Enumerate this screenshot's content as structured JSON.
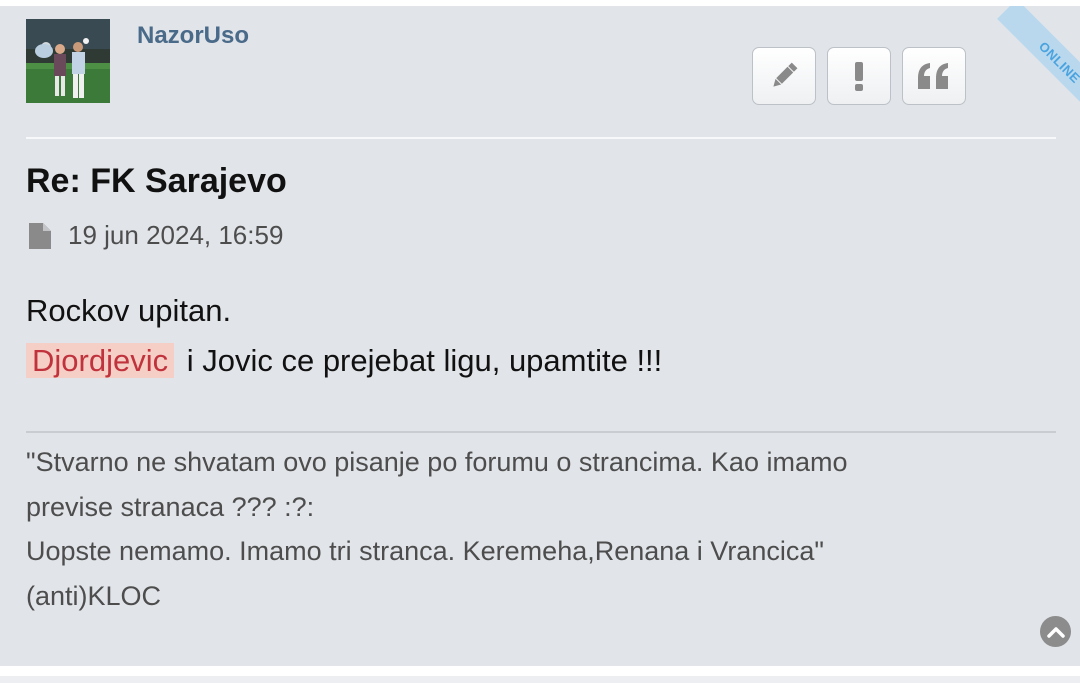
{
  "post": {
    "author": "NazorUso",
    "online_badge": "ONLINE",
    "buttons": [
      {
        "name": "edit",
        "icon": "pencil-icon"
      },
      {
        "name": "report",
        "icon": "exclamation-icon"
      },
      {
        "name": "quote",
        "icon": "quote-icon"
      }
    ],
    "title": "Re: FK Sarajevo",
    "date": "19 jun 2024, 16:59",
    "body": {
      "line1": "Rockov upitan.",
      "mention": "Djordjevic",
      "line2_rest": " i Jovic ce prejebat ligu, upamtite !!!"
    },
    "signature": {
      "line1": "\"Stvarno ne shvatam ovo pisanje po forumu o strancima. Kao imamo",
      "line2": "previse stranaca ??? :?:",
      "line3": "Uopste nemamo. Imamo tri stranca. Keremeha,Renana i Vrancica\"",
      "line4": "(anti)KLOC"
    }
  },
  "colors": {
    "post_background": "#e1e4e8",
    "username": "#4a6a8a",
    "mention_background": "#f5cfc6",
    "mention_text": "#c0333d",
    "online_ribbon": "#b9d8ee"
  }
}
